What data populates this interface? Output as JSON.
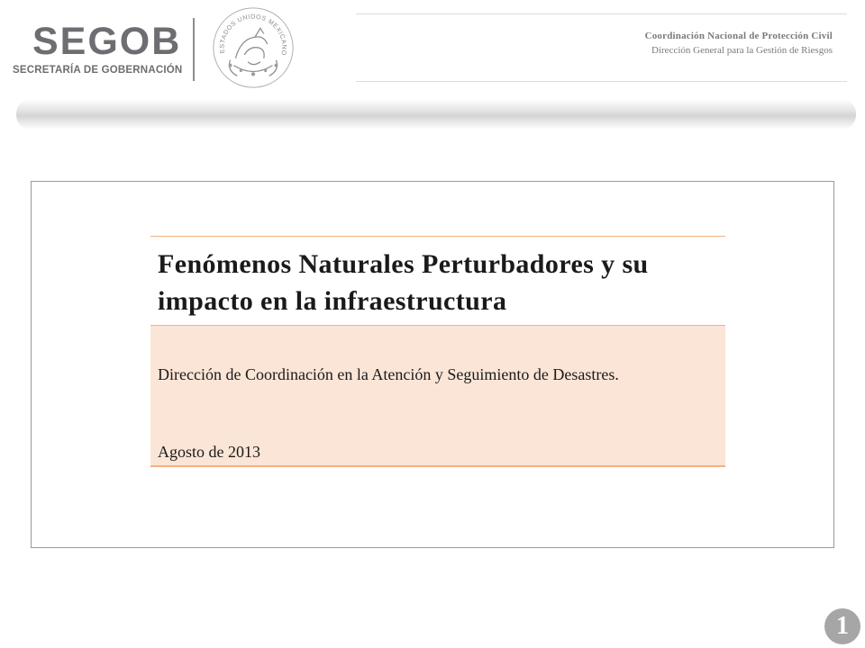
{
  "header": {
    "logo_name": "SEGOB",
    "logo_subtitle": "SECRETARÍA DE GOBERNACIÓN",
    "seal_text": "ESTADOS UNIDOS MEXICANOS",
    "org_title": "Coordinación Nacional de Protección Civil",
    "org_subtitle": "Dirección General para la Gestión de Riesgos"
  },
  "slide": {
    "title": "Fenómenos Naturales Perturbadores y su impacto en la infraestructura",
    "department": "Dirección de Coordinación en la Atención y Seguimiento de Desastres.",
    "date": "Agosto de 2013",
    "page_number": "1"
  },
  "colors": {
    "accent_border": "#f4b183",
    "info_background": "#fbe5d6",
    "logo_gray": "#6d6e71"
  },
  "icons": {
    "seal": "mexican-coat-of-arms-icon"
  }
}
